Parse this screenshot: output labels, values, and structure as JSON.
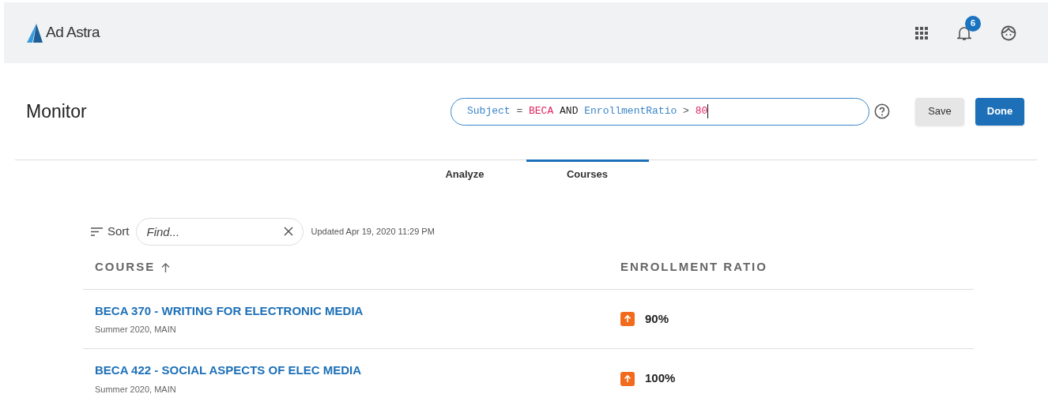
{
  "header": {
    "brand": "Ad Astra",
    "notifications": "6"
  },
  "page": {
    "title": "Monitor",
    "query": [
      {
        "kind": "field",
        "text": "Subject"
      },
      {
        "kind": "op",
        "text": "="
      },
      {
        "kind": "value",
        "text": "BECA"
      },
      {
        "kind": "keyword",
        "text": "AND"
      },
      {
        "kind": "field",
        "text": "EnrollmentRatio"
      },
      {
        "kind": "op",
        "text": ">"
      },
      {
        "kind": "value",
        "text": "80"
      }
    ],
    "buttons": [
      {
        "label": "Save",
        "kind": "secondary"
      },
      {
        "label": "Done",
        "kind": "primary"
      }
    ]
  },
  "tabs": [
    {
      "label": "Analyze",
      "selected": false
    },
    {
      "label": "Courses",
      "selected": true
    }
  ],
  "toolbar": {
    "sort": "Sort",
    "search": {
      "placeholder": "Find..."
    },
    "updated": "Updated Apr 19, 2020 11:29 PM"
  },
  "table": {
    "columns": [
      {
        "label": "COURSE",
        "sorted": true
      },
      {
        "label": "ENROLLMENT RATIO",
        "sorted": false
      }
    ],
    "rows": [
      {
        "course": "BECA 370 - WRITING FOR ELECTRONIC MEDIA",
        "term": "Summer 2020, MAIN",
        "kind": "up",
        "ratio": "90%"
      },
      {
        "course": "BECA 422 - SOCIAL ASPECTS OF ELEC MEDIA",
        "term": "Summer 2020, MAIN",
        "kind": "up",
        "ratio": "100%"
      }
    ]
  }
}
